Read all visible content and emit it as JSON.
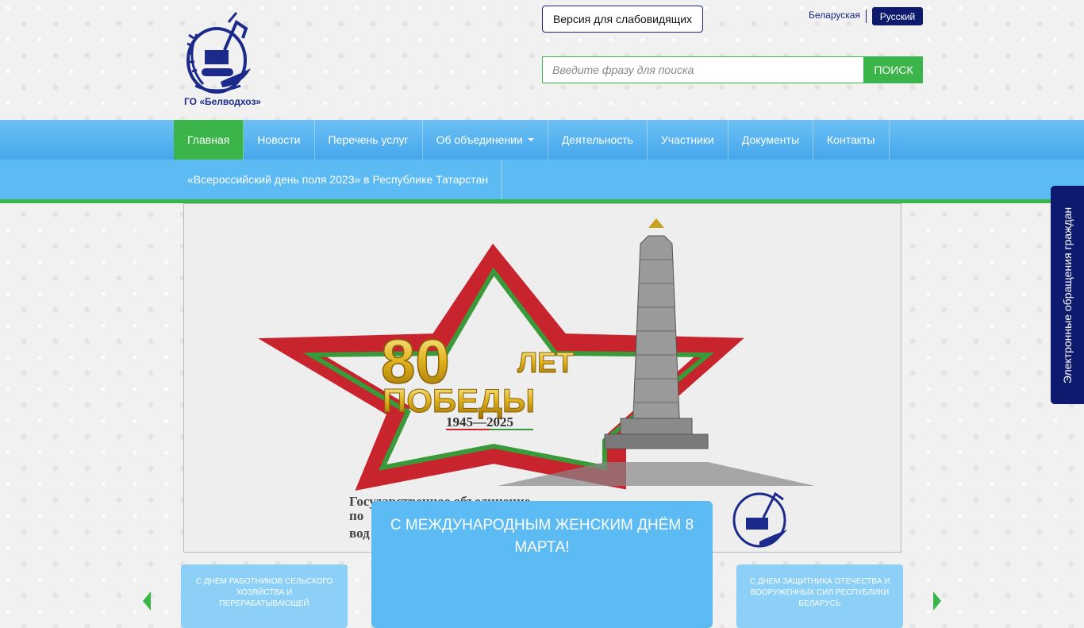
{
  "header": {
    "logo_text": "ГО «Белводхоз»",
    "low_vision_label": "Версия для слабовидящих",
    "lang_be": "Беларуская",
    "lang_ru": "Русский",
    "search_placeholder": "Введите фразу для поиска",
    "search_button": "ПОИСК"
  },
  "nav": {
    "items": [
      {
        "label": "Главная"
      },
      {
        "label": "Новости"
      },
      {
        "label": "Перечень услуг"
      },
      {
        "label": "Об объединении"
      },
      {
        "label": "Деятельность"
      },
      {
        "label": "Участники"
      },
      {
        "label": "Документы"
      },
      {
        "label": "Контакты"
      }
    ],
    "sub_item": "«Всероссийский день поля 2023» в Республике Татарстан"
  },
  "banner": {
    "big_number": "80",
    "word1": "ЛЕТ",
    "word2": "ПОБЕДЫ",
    "years": "1945—2025",
    "caption_lines": [
      "Государственное объединение",
      "по",
      "вод"
    ]
  },
  "slider": {
    "active_title": "С МЕЖДУНАРОДНЫМ ЖЕНСКИМ ДНЁМ 8 МАРТА!",
    "left_card": "С ДНЕМ РАБОТНИКОВ СЕЛЬСКОГО ХОЗЯЙСТВА И ПЕРЕРАБАТЫВАЮЩЕЙ",
    "right_card": "С ДНЕМ ЗАЩИТНИКА ОТЕЧЕСТВА И ВООРУЖЕННЫХ СИЛ РЕСПУБЛИКИ БЕЛАРУСЬ"
  },
  "side_tab": {
    "label": "Электронные обращения граждан"
  },
  "colors": {
    "navy": "#0d1a6e",
    "green": "#3bb54a",
    "sky": "#5cbbf2"
  }
}
